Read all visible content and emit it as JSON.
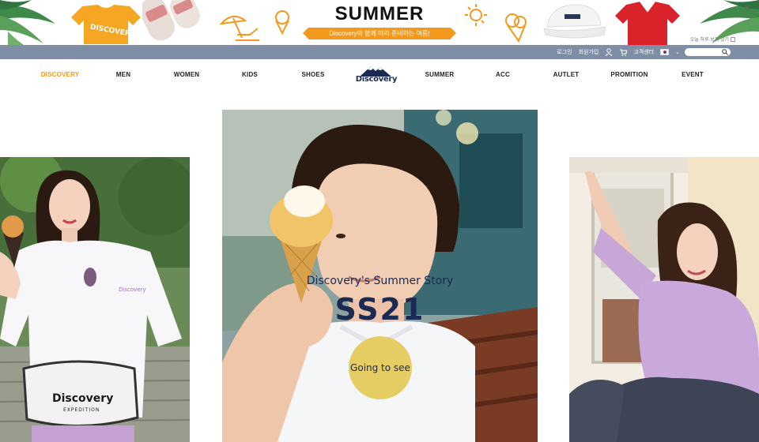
{
  "promo": {
    "title": "SUMMER",
    "subtitle": "Discovery와 함께 미리 준비하는 여름!",
    "tshirt_text": "DISCOVERY",
    "today_hide": "오늘 하루 보지 않기",
    "close_icon": "close-icon"
  },
  "util": {
    "login": "로그인",
    "join": "회원가입",
    "customer_center": "고객센터",
    "search_placeholder": "",
    "colors": {
      "bar": "#7f8da5"
    }
  },
  "nav": {
    "items": [
      "DISCOVERY",
      "MEN",
      "WOMEN",
      "KIDS",
      "SHOES",
      "SUMMER",
      "ACC",
      "AUTLET",
      "PROMITION",
      "EVENT"
    ],
    "active_index": 0,
    "logo_text": "Discovery",
    "colors": {
      "active": "#f39a1e",
      "text": "#222222"
    }
  },
  "hero": {
    "subtitle": "Discovery's Summer Story",
    "title": "SS21",
    "button": "Going to see",
    "left_shirt_brand": "Discovery",
    "left_bag_brand": "Discovery",
    "left_bag_sub": "EXPEDITION",
    "colors": {
      "button": "#e6cd63",
      "text": "#1a2a52"
    }
  }
}
